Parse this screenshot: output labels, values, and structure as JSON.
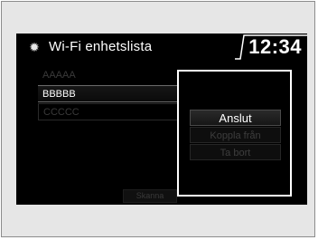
{
  "header": {
    "title": "Wi-Fi enhetslista",
    "time": "12:34",
    "icon": "gear-icon"
  },
  "devices": [
    {
      "name": "AAAAA",
      "state": "dim"
    },
    {
      "name": "BBBBB",
      "state": "active"
    },
    {
      "name": "CCCCC",
      "state": "outline"
    }
  ],
  "bottom_button": {
    "label": "Skanna"
  },
  "popup": {
    "connect": "Anslut",
    "disconnect": "Koppla från",
    "remove": "Ta bort"
  },
  "colors": {
    "screen_bg": "#000000",
    "text_active": "#ffffff",
    "text_disabled": "#3a3a3a"
  }
}
